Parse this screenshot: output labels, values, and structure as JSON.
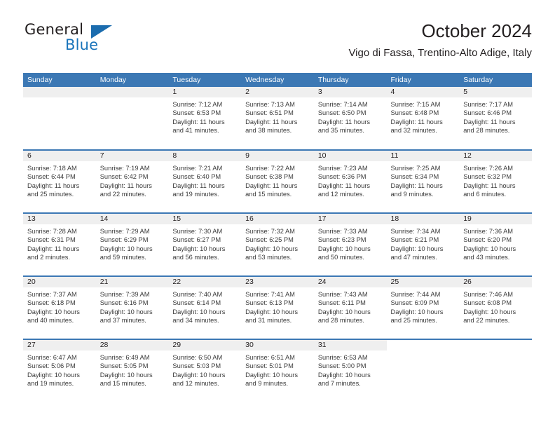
{
  "brand": {
    "name_part1": "General",
    "name_part2": "Blue",
    "triangle_icon": "brand-triangle-icon",
    "accent_color": "#1b75bb"
  },
  "header": {
    "title": "October 2024",
    "subtitle": "Vigo di Fassa, Trentino-Alto Adige, Italy"
  },
  "colors": {
    "header_blue": "#3c78b4",
    "daynum_band": "#efefef",
    "text": "#231f20"
  },
  "weekday_headers": [
    "Sunday",
    "Monday",
    "Tuesday",
    "Wednesday",
    "Thursday",
    "Friday",
    "Saturday"
  ],
  "weeks": [
    [
      {
        "day": "",
        "empty": true,
        "sunrise": "",
        "sunset": "",
        "daylight_line1": "",
        "daylight_line2": ""
      },
      {
        "day": "",
        "empty": true,
        "sunrise": "",
        "sunset": "",
        "daylight_line1": "",
        "daylight_line2": ""
      },
      {
        "day": "1",
        "sunrise": "Sunrise: 7:12 AM",
        "sunset": "Sunset: 6:53 PM",
        "daylight_line1": "Daylight: 11 hours",
        "daylight_line2": "and 41 minutes."
      },
      {
        "day": "2",
        "sunrise": "Sunrise: 7:13 AM",
        "sunset": "Sunset: 6:51 PM",
        "daylight_line1": "Daylight: 11 hours",
        "daylight_line2": "and 38 minutes."
      },
      {
        "day": "3",
        "sunrise": "Sunrise: 7:14 AM",
        "sunset": "Sunset: 6:50 PM",
        "daylight_line1": "Daylight: 11 hours",
        "daylight_line2": "and 35 minutes."
      },
      {
        "day": "4",
        "sunrise": "Sunrise: 7:15 AM",
        "sunset": "Sunset: 6:48 PM",
        "daylight_line1": "Daylight: 11 hours",
        "daylight_line2": "and 32 minutes."
      },
      {
        "day": "5",
        "sunrise": "Sunrise: 7:17 AM",
        "sunset": "Sunset: 6:46 PM",
        "daylight_line1": "Daylight: 11 hours",
        "daylight_line2": "and 28 minutes."
      }
    ],
    [
      {
        "day": "6",
        "sunrise": "Sunrise: 7:18 AM",
        "sunset": "Sunset: 6:44 PM",
        "daylight_line1": "Daylight: 11 hours",
        "daylight_line2": "and 25 minutes."
      },
      {
        "day": "7",
        "sunrise": "Sunrise: 7:19 AM",
        "sunset": "Sunset: 6:42 PM",
        "daylight_line1": "Daylight: 11 hours",
        "daylight_line2": "and 22 minutes."
      },
      {
        "day": "8",
        "sunrise": "Sunrise: 7:21 AM",
        "sunset": "Sunset: 6:40 PM",
        "daylight_line1": "Daylight: 11 hours",
        "daylight_line2": "and 19 minutes."
      },
      {
        "day": "9",
        "sunrise": "Sunrise: 7:22 AM",
        "sunset": "Sunset: 6:38 PM",
        "daylight_line1": "Daylight: 11 hours",
        "daylight_line2": "and 15 minutes."
      },
      {
        "day": "10",
        "sunrise": "Sunrise: 7:23 AM",
        "sunset": "Sunset: 6:36 PM",
        "daylight_line1": "Daylight: 11 hours",
        "daylight_line2": "and 12 minutes."
      },
      {
        "day": "11",
        "sunrise": "Sunrise: 7:25 AM",
        "sunset": "Sunset: 6:34 PM",
        "daylight_line1": "Daylight: 11 hours",
        "daylight_line2": "and 9 minutes."
      },
      {
        "day": "12",
        "sunrise": "Sunrise: 7:26 AM",
        "sunset": "Sunset: 6:32 PM",
        "daylight_line1": "Daylight: 11 hours",
        "daylight_line2": "and 6 minutes."
      }
    ],
    [
      {
        "day": "13",
        "sunrise": "Sunrise: 7:28 AM",
        "sunset": "Sunset: 6:31 PM",
        "daylight_line1": "Daylight: 11 hours",
        "daylight_line2": "and 2 minutes."
      },
      {
        "day": "14",
        "sunrise": "Sunrise: 7:29 AM",
        "sunset": "Sunset: 6:29 PM",
        "daylight_line1": "Daylight: 10 hours",
        "daylight_line2": "and 59 minutes."
      },
      {
        "day": "15",
        "sunrise": "Sunrise: 7:30 AM",
        "sunset": "Sunset: 6:27 PM",
        "daylight_line1": "Daylight: 10 hours",
        "daylight_line2": "and 56 minutes."
      },
      {
        "day": "16",
        "sunrise": "Sunrise: 7:32 AM",
        "sunset": "Sunset: 6:25 PM",
        "daylight_line1": "Daylight: 10 hours",
        "daylight_line2": "and 53 minutes."
      },
      {
        "day": "17",
        "sunrise": "Sunrise: 7:33 AM",
        "sunset": "Sunset: 6:23 PM",
        "daylight_line1": "Daylight: 10 hours",
        "daylight_line2": "and 50 minutes."
      },
      {
        "day": "18",
        "sunrise": "Sunrise: 7:34 AM",
        "sunset": "Sunset: 6:21 PM",
        "daylight_line1": "Daylight: 10 hours",
        "daylight_line2": "and 47 minutes."
      },
      {
        "day": "19",
        "sunrise": "Sunrise: 7:36 AM",
        "sunset": "Sunset: 6:20 PM",
        "daylight_line1": "Daylight: 10 hours",
        "daylight_line2": "and 43 minutes."
      }
    ],
    [
      {
        "day": "20",
        "sunrise": "Sunrise: 7:37 AM",
        "sunset": "Sunset: 6:18 PM",
        "daylight_line1": "Daylight: 10 hours",
        "daylight_line2": "and 40 minutes."
      },
      {
        "day": "21",
        "sunrise": "Sunrise: 7:39 AM",
        "sunset": "Sunset: 6:16 PM",
        "daylight_line1": "Daylight: 10 hours",
        "daylight_line2": "and 37 minutes."
      },
      {
        "day": "22",
        "sunrise": "Sunrise: 7:40 AM",
        "sunset": "Sunset: 6:14 PM",
        "daylight_line1": "Daylight: 10 hours",
        "daylight_line2": "and 34 minutes."
      },
      {
        "day": "23",
        "sunrise": "Sunrise: 7:41 AM",
        "sunset": "Sunset: 6:13 PM",
        "daylight_line1": "Daylight: 10 hours",
        "daylight_line2": "and 31 minutes."
      },
      {
        "day": "24",
        "sunrise": "Sunrise: 7:43 AM",
        "sunset": "Sunset: 6:11 PM",
        "daylight_line1": "Daylight: 10 hours",
        "daylight_line2": "and 28 minutes."
      },
      {
        "day": "25",
        "sunrise": "Sunrise: 7:44 AM",
        "sunset": "Sunset: 6:09 PM",
        "daylight_line1": "Daylight: 10 hours",
        "daylight_line2": "and 25 minutes."
      },
      {
        "day": "26",
        "sunrise": "Sunrise: 7:46 AM",
        "sunset": "Sunset: 6:08 PM",
        "daylight_line1": "Daylight: 10 hours",
        "daylight_line2": "and 22 minutes."
      }
    ],
    [
      {
        "day": "27",
        "sunrise": "Sunrise: 6:47 AM",
        "sunset": "Sunset: 5:06 PM",
        "daylight_line1": "Daylight: 10 hours",
        "daylight_line2": "and 19 minutes."
      },
      {
        "day": "28",
        "sunrise": "Sunrise: 6:49 AM",
        "sunset": "Sunset: 5:05 PM",
        "daylight_line1": "Daylight: 10 hours",
        "daylight_line2": "and 15 minutes."
      },
      {
        "day": "29",
        "sunrise": "Sunrise: 6:50 AM",
        "sunset": "Sunset: 5:03 PM",
        "daylight_line1": "Daylight: 10 hours",
        "daylight_line2": "and 12 minutes."
      },
      {
        "day": "30",
        "sunrise": "Sunrise: 6:51 AM",
        "sunset": "Sunset: 5:01 PM",
        "daylight_line1": "Daylight: 10 hours",
        "daylight_line2": "and 9 minutes."
      },
      {
        "day": "31",
        "sunrise": "Sunrise: 6:53 AM",
        "sunset": "Sunset: 5:00 PM",
        "daylight_line1": "Daylight: 10 hours",
        "daylight_line2": "and 7 minutes."
      },
      {
        "day": "",
        "blank": true,
        "sunrise": "",
        "sunset": "",
        "daylight_line1": "",
        "daylight_line2": ""
      },
      {
        "day": "",
        "blank": true,
        "sunrise": "",
        "sunset": "",
        "daylight_line1": "",
        "daylight_line2": ""
      }
    ]
  ]
}
